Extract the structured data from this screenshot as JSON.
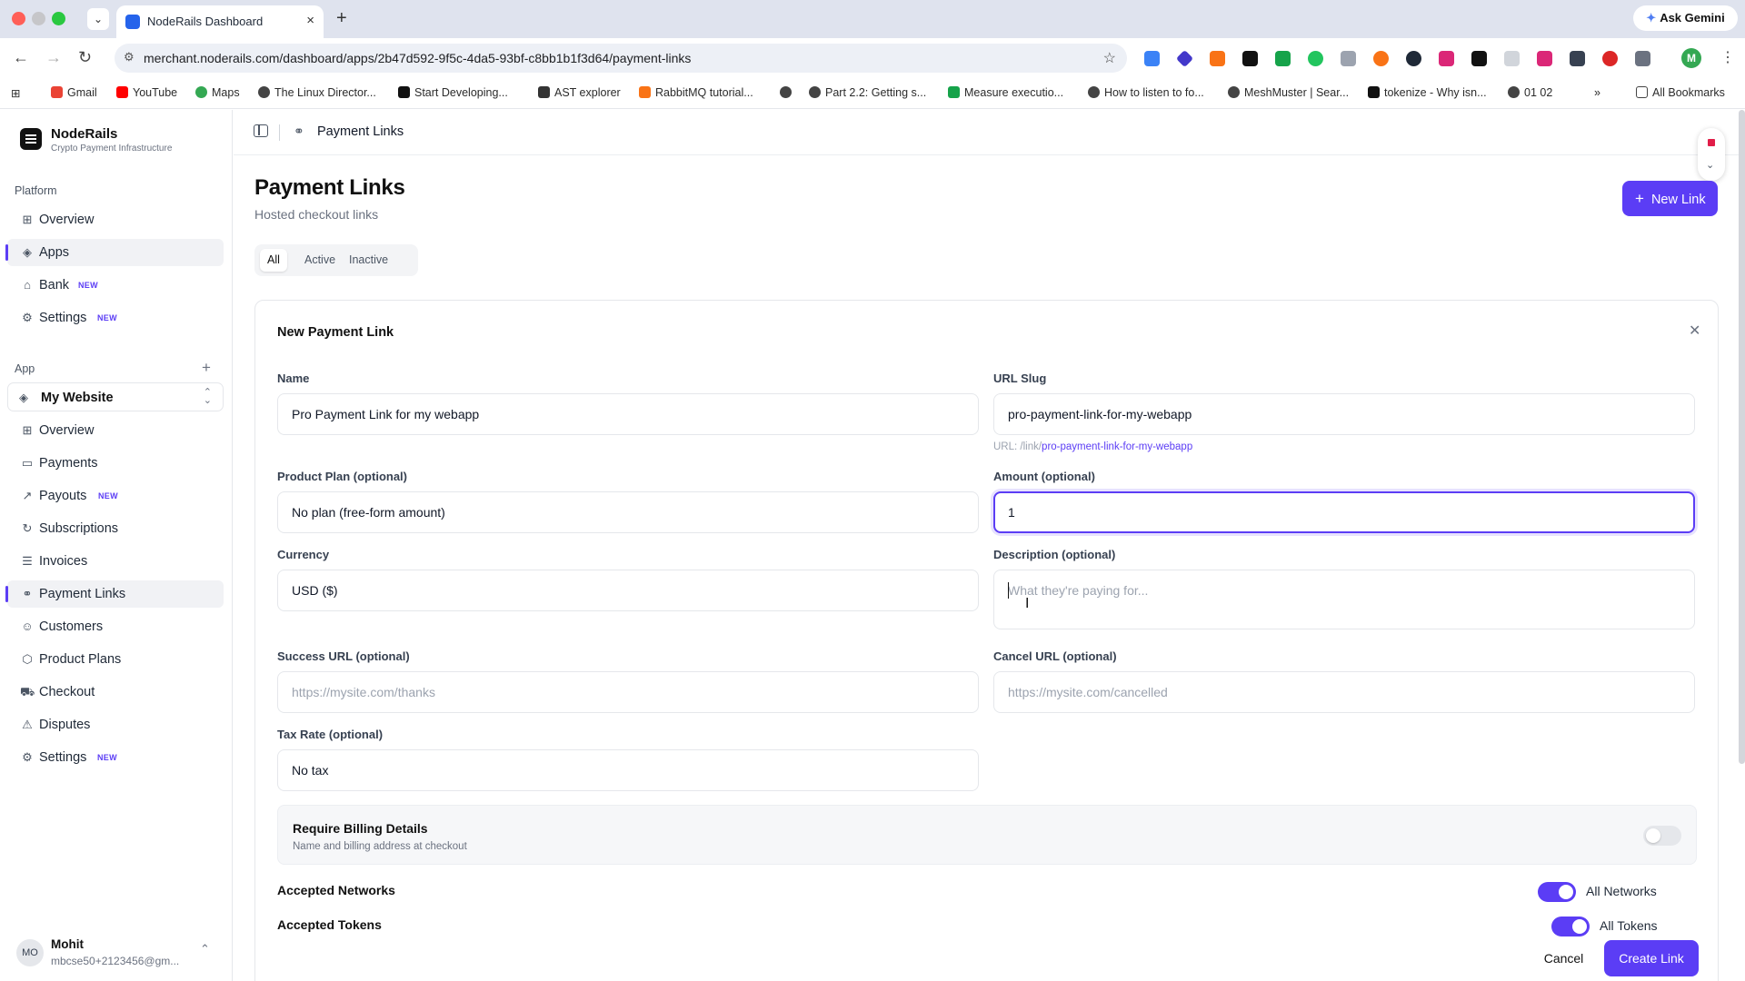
{
  "browser": {
    "tab_title": "NodeRails Dashboard",
    "url": "merchant.noderails.com/dashboard/apps/2b47d592-9f5c-4da5-93bf-c8bb1b1f3d64/payment-links",
    "ask_gemini": "Ask Gemini",
    "profile_initial": "M",
    "bookmarks": [
      "Gmail",
      "YouTube",
      "Maps",
      "The Linux Director...",
      "Start Developing...",
      "AST explorer",
      "RabbitMQ tutorial...",
      "Part 2.2: Getting s...",
      "Measure executio...",
      "How to listen to fo...",
      "MeshMuster | Sear...",
      "tokenize - Why isn...",
      "01 02"
    ],
    "all_bookmarks": "All Bookmarks"
  },
  "brand": {
    "name": "NodeRails",
    "subtitle": "Crypto Payment Infrastructure"
  },
  "sidebar": {
    "platform_label": "Platform",
    "platform_items": [
      {
        "label": "Overview",
        "icon": "grid-icon"
      },
      {
        "label": "Apps",
        "icon": "layers-icon"
      },
      {
        "label": "Bank",
        "icon": "bank-icon",
        "badge": "NEW"
      },
      {
        "label": "Settings",
        "icon": "gear-icon",
        "badge": "NEW"
      }
    ],
    "app_label": "App",
    "app_selector": "My Website",
    "app_items": [
      {
        "label": "Overview",
        "icon": "grid-icon"
      },
      {
        "label": "Payments",
        "icon": "card-icon"
      },
      {
        "label": "Payouts",
        "icon": "arrow-up-right-icon",
        "badge": "NEW"
      },
      {
        "label": "Subscriptions",
        "icon": "refresh-icon"
      },
      {
        "label": "Invoices",
        "icon": "list-icon"
      },
      {
        "label": "Payment Links",
        "icon": "link-icon"
      },
      {
        "label": "Customers",
        "icon": "users-icon"
      },
      {
        "label": "Product Plans",
        "icon": "box-icon"
      },
      {
        "label": "Checkout",
        "icon": "cart-icon"
      },
      {
        "label": "Disputes",
        "icon": "warning-icon"
      },
      {
        "label": "Settings",
        "icon": "gear-icon",
        "badge": "NEW"
      }
    ],
    "user": {
      "initials": "MO",
      "name": "Mohit",
      "email": "mbcse50+2123456@gm..."
    }
  },
  "header": {
    "breadcrumb": "Payment Links"
  },
  "page": {
    "title": "Payment Links",
    "subtitle": "Hosted checkout links",
    "new_button": "New Link",
    "tabs": [
      "All",
      "Active",
      "Inactive"
    ]
  },
  "form": {
    "title": "New Payment Link",
    "name": {
      "label": "Name",
      "value": "Pro Payment Link for my webapp"
    },
    "slug": {
      "label": "URL Slug",
      "value": "pro-payment-link-for-my-webapp",
      "hint_prefix": "URL: /link/",
      "hint_value": "pro-payment-link-for-my-webapp"
    },
    "plan": {
      "label": "Product Plan (optional)",
      "value": "No plan (free-form amount)"
    },
    "amount": {
      "label": "Amount (optional)",
      "value": "1"
    },
    "currency": {
      "label": "Currency",
      "value": "USD ($)"
    },
    "description": {
      "label": "Description (optional)",
      "placeholder": "What they're paying for..."
    },
    "success_url": {
      "label": "Success URL (optional)",
      "placeholder": "https://mysite.com/thanks"
    },
    "cancel_url": {
      "label": "Cancel URL (optional)",
      "placeholder": "https://mysite.com/cancelled"
    },
    "tax": {
      "label": "Tax Rate (optional)",
      "value": "No tax"
    },
    "billing": {
      "title": "Require Billing Details",
      "subtitle": "Name and billing address at checkout",
      "enabled": false
    },
    "networks": {
      "label": "Accepted Networks",
      "toggle_text": "All Networks",
      "enabled": true
    },
    "tokens": {
      "label": "Accepted Tokens",
      "toggle_text": "All Tokens",
      "enabled": true
    },
    "cancel_button": "Cancel",
    "create_button": "Create Link"
  },
  "colors": {
    "accent": "#5b3df5"
  }
}
